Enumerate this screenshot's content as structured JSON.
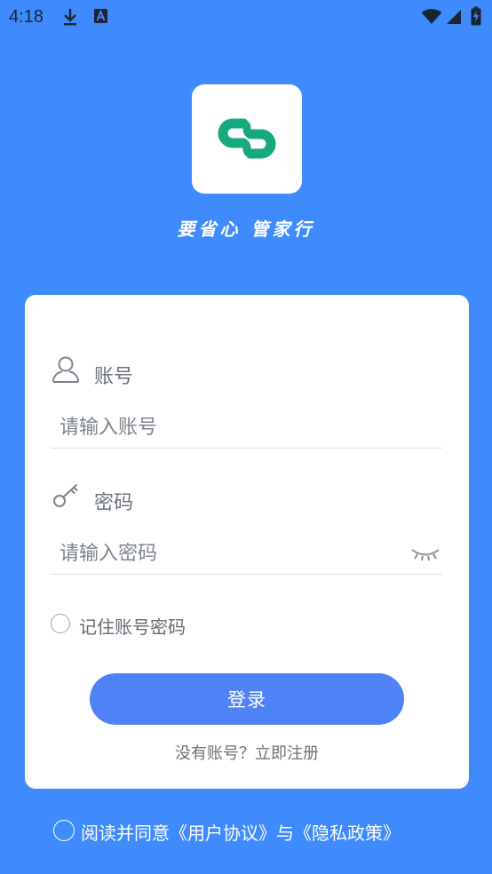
{
  "status_bar": {
    "time": "4:18",
    "icons": [
      "download-icon",
      "a-badge-icon",
      "wifi-icon",
      "signal-icon",
      "battery-icon"
    ]
  },
  "logo": {
    "icon": "app-logo-icon",
    "color": "#17a87f"
  },
  "slogan": "要省心 管家行",
  "form": {
    "account_label": "账号",
    "account_placeholder": "请输入账号",
    "password_label": "密码",
    "password_placeholder": "请输入密码",
    "remember_label": "记住账号密码",
    "login_button": "登录",
    "register_link": "没有账号？立即注册"
  },
  "agreement": {
    "text": "阅读并同意《用户协议》与《隐私政策》"
  },
  "colors": {
    "background": "#3f8bfd",
    "button": "#4f82f7",
    "logo_green": "#17a87f"
  }
}
